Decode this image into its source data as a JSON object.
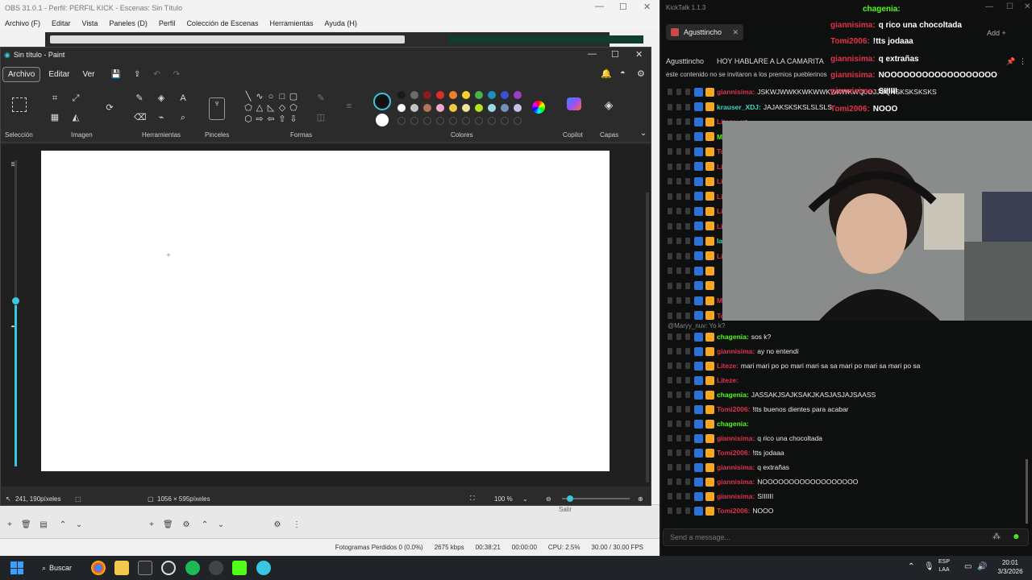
{
  "obs": {
    "title": "OBS 31.0.1 - Perfil: PERFIL KICK - Escenas: Sin Título",
    "menu": [
      "Archivo (F)",
      "Editar",
      "Vista",
      "Paneles (D)",
      "Perfil",
      "Colección de Escenas",
      "Herramientas",
      "Ayuda (H)"
    ],
    "status": {
      "dropped_frames": "Fotogramas Perdidos 0 (0.0%)",
      "bitrate": "2675 kbps",
      "stream_time": "00:38:21",
      "rec_time": "00:00:00",
      "cpu": "CPU: 2.5%",
      "fps": "30.00 / 30.00 FPS"
    },
    "exit_label": "Salir"
  },
  "paint": {
    "title": "Sin título - Paint",
    "menu": [
      "Archivo",
      "Editar",
      "Ver"
    ],
    "groups": {
      "selection": "Selección",
      "image": "Imagen",
      "tools": "Herramientas",
      "brushes": "Pinceles",
      "shapes": "Formas",
      "colors": "Colores",
      "copilot": "Copilot",
      "layers": "Capas"
    },
    "colors_row1": [
      "#1a1a1a",
      "#6b6b6b",
      "#8b1a1a",
      "#e02b2b",
      "#f07e2b",
      "#f5d32b",
      "#46b64a",
      "#1c8fbf",
      "#3e4fd4",
      "#9b3fc2"
    ],
    "colors_row2": [
      "#ffffff",
      "#c3c3c3",
      "#b5735a",
      "#f5a9c8",
      "#f5c542",
      "#efe59d",
      "#b5e61d",
      "#99d9ea",
      "#7092be",
      "#c8bfe7"
    ],
    "status": {
      "cursor": "241, 190píxeles",
      "canvas_size": "1056 × 595píxeles",
      "zoom": "100 %"
    }
  },
  "kicktalk": {
    "title": "KickTalk 1.1.3",
    "tab": "Agusttincho",
    "streamer": "Agusttincho",
    "stream_title": "HOY HABLARE A LA CAMARITA",
    "info": "este contenido no se invitaron a los premios pueblerinos",
    "overlay": [
      {
        "user": "chagenia:",
        "text": ""
      },
      {
        "user": "giannisima:",
        "text": "q rico una chocoltada"
      },
      {
        "user": "Tomi2006:",
        "text": "!tts jodaaa"
      },
      {
        "user": "giannisima:",
        "text": "q extrañas"
      },
      {
        "user": "giannisima:",
        "text": "NOOOOOOOOOOOOOOOOOO"
      },
      {
        "user": "giannisima:",
        "text": "SIIIIII"
      },
      {
        "user": "Tomi2006:",
        "text": "NOOO"
      }
    ],
    "messages": [
      {
        "user": "giannisima:",
        "color": "u-red",
        "text": "JSKWJWWKKWKWWKWKWKWQJOJJOQNSKSKSKSKS"
      },
      {
        "user": "krauser_XDJ:",
        "color": "u-teal",
        "text": "JAJAKSKSKSLSLSLS"
      },
      {
        "user": "Liteze:",
        "color": "u-red",
        "text": "yo"
      },
      {
        "user": "Mario...:",
        "color": "u-green",
        "text": ""
      },
      {
        "user": "Tomi2...",
        "color": "u-red",
        "text": ""
      },
      {
        "user": "Lite...",
        "color": "u-red",
        "text": ""
      },
      {
        "user": "Lite...",
        "color": "u-red",
        "text": ""
      },
      {
        "user": "Lite...",
        "color": "u-red",
        "text": ""
      },
      {
        "user": "Lite...",
        "color": "u-red",
        "text": ""
      },
      {
        "user": "Lite...",
        "color": "u-red",
        "text": ""
      },
      {
        "user": "lacupid...",
        "color": "u-teal",
        "text": ""
      },
      {
        "user": "Lite...",
        "color": "u-red",
        "text": ""
      },
      {
        "user": "",
        "color": "u-red",
        "text": ""
      },
      {
        "user": "",
        "color": "u-red",
        "text": ""
      },
      {
        "user": "Maryy_...",
        "color": "u-red",
        "text": ""
      },
      {
        "user": "Tomi2...",
        "color": "u-red",
        "text": ""
      }
    ],
    "reply_hint": "@Maryy_nuv: Yo k?",
    "messages2": [
      {
        "user": "chagenia:",
        "color": "u-green",
        "text": "sos k?"
      },
      {
        "user": "giannisima:",
        "color": "u-red",
        "text": "ay no entendí"
      },
      {
        "user": "Liteze:",
        "color": "u-red",
        "text": "mari mari po po mari mari sa sa mari po mari sa mari po sa"
      },
      {
        "user": "Liteze:",
        "color": "u-red",
        "text": ""
      },
      {
        "user": "chagenia:",
        "color": "u-green",
        "text": "JASSAKJSAJKSAKJKASJASJAJSAASS"
      },
      {
        "user": "Tomi2006:",
        "color": "u-red",
        "text": "!tts buenos dientes para acabar"
      },
      {
        "user": "chagenia:",
        "color": "u-green",
        "text": ""
      },
      {
        "user": "giannisima:",
        "color": "u-red",
        "text": "q rico una chocoltada"
      },
      {
        "user": "Tomi2006:",
        "color": "u-red",
        "text": "!tts jodaaa"
      },
      {
        "user": "giannisima:",
        "color": "u-red",
        "text": "q extrañas"
      },
      {
        "user": "giannisima:",
        "color": "u-red",
        "text": "NOOOOOOOOOOOOOOOOOO"
      },
      {
        "user": "giannisima:",
        "color": "u-red",
        "text": "SIIIIII"
      },
      {
        "user": "Tomi2006:",
        "color": "u-red",
        "text": "NOOO"
      }
    ],
    "input_placeholder": "Send a message..."
  },
  "taskbar": {
    "search": "Buscar",
    "lang1": "ESP",
    "lang2": "LAA",
    "time": "20:01",
    "date": "3/3/2026"
  }
}
